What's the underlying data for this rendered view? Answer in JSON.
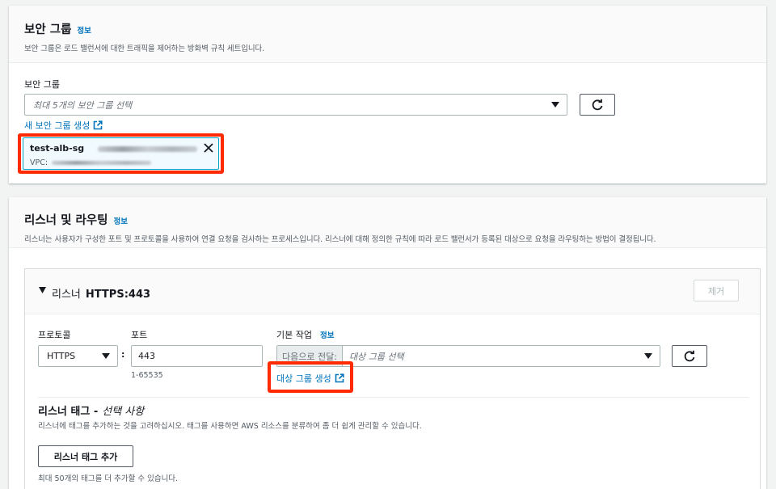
{
  "security_group": {
    "title": "보안 그룹",
    "info": "정보",
    "description": "보안 그룹은 로드 밸런서에 대한 트래픽을 제어하는 방화벽 규칙 세트입니다.",
    "field_label": "보안 그룹",
    "select_placeholder": "최대 5개의 보안 그룹 선택",
    "create_link": "새 보안 그룹 생성",
    "token": {
      "name": "test-alb-sg",
      "vpc_label": "VPC:"
    }
  },
  "listeners": {
    "title": "리스너 및 라우팅",
    "info": "정보",
    "description": "리스너는 사용자가 구성한 포트 및 프로토콜을 사용하여 연결 요청을 검사하는 프로세스입니다. 리스너에 대해 정의한 규칙에 따라 로드 밸런서가 등록된 대상으로 요청을 라우팅하는 방법이 결정됩니다.",
    "listener": {
      "label_prefix": "리스너",
      "label_name": "HTTPS:443",
      "remove_button": "제거",
      "protocol_label": "프로토콜",
      "protocol_value": "HTTPS",
      "colon": ":",
      "port_label": "포트",
      "port_value": "443",
      "port_hint": "1-65535",
      "default_action_label": "기본 작업",
      "default_action_info": "정보",
      "forward_prefix": "다음으로 전달:",
      "target_placeholder": "대상 그룹 선택",
      "create_target_link": "대상 그룹 생성",
      "tags_title": "리스너 태그 -",
      "tags_optional": "선택 사항",
      "tags_description": "리스너에 태그를 추가하는 것을 고려하십시오. 태그를 사용하면 AWS 리소스를 분류하여 좀 더 쉽게 관리할 수 있습니다.",
      "add_tag_button": "리스너 태그 추가",
      "tags_limit": "최대 50개의 태그를 더 추가할 수 있습니다."
    }
  },
  "colors": {
    "link": "#0073bb",
    "highlight": "#ff2a00",
    "border": "#aab7b8"
  }
}
